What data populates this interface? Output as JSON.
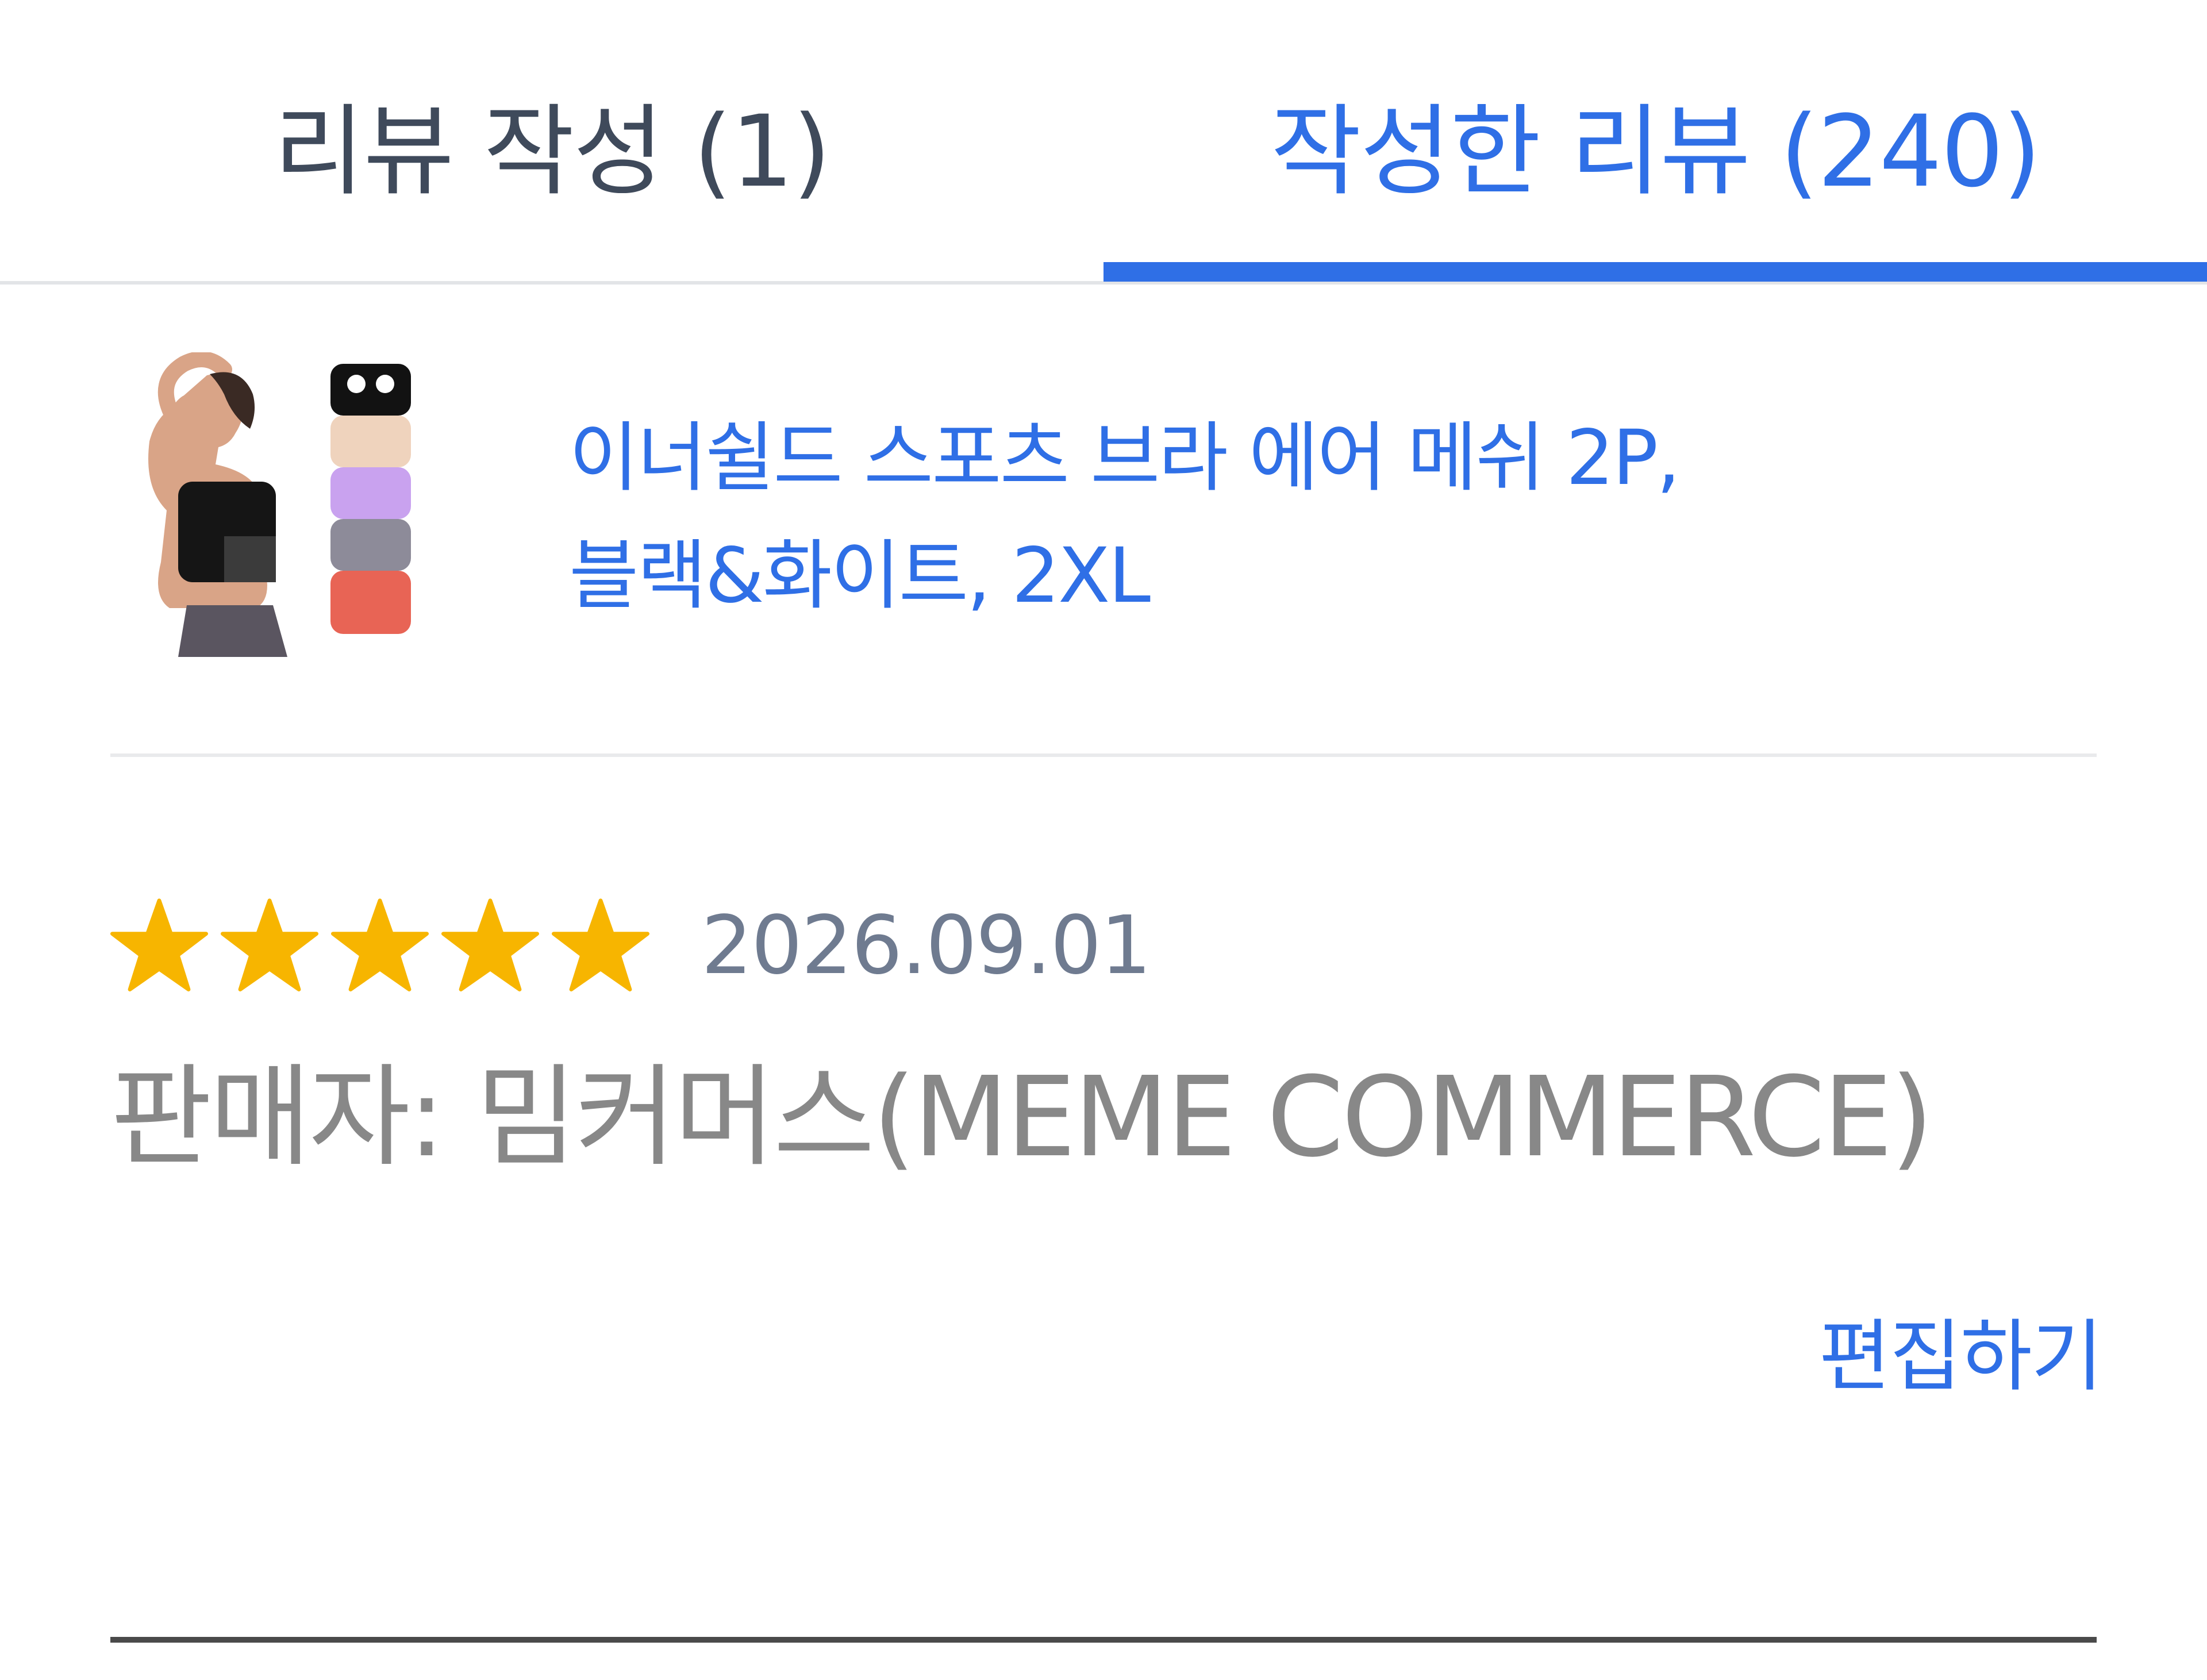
{
  "tabs": {
    "write_review": "리뷰 작성 (1)",
    "written_reviews": "작성한 리뷰 (240)",
    "active": "written_reviews"
  },
  "product": {
    "name_line1": "이너쉴드 스포츠 브라 에어 메쉬 2P,",
    "name_line2": "블랙&화이트, 2XL",
    "image_icon": "product-thumbnail-sports-bra"
  },
  "review": {
    "rating": 5,
    "rating_max": 5,
    "date": "2026.09.01",
    "seller": "판매자: 밈커머스(MEME COMMERCE)",
    "edit_label": "편집하기"
  },
  "colors": {
    "accent": "#2f6fe6",
    "star": "#f7b500",
    "tab_inactive": "#3f4a5b",
    "date_text": "#6f7b90",
    "seller_text": "#888888"
  }
}
